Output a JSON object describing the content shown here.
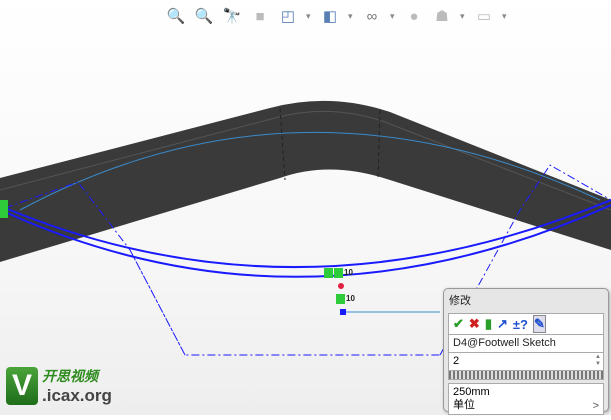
{
  "toolbar": {
    "icons": [
      "zoom-to-fit-icon",
      "zoom-area-icon",
      "previous-view-icon",
      "section-view-icon",
      "view-orientation-icon",
      "display-style-icon",
      "hide-show-icon",
      "edit-appearance-icon",
      "apply-scene-icon",
      "view-settings-icon"
    ]
  },
  "sketch": {
    "dim_label_1": "10",
    "dim_label_2": "10"
  },
  "modify_dialog": {
    "title": "修改",
    "dimension_name": "D4@Footwell Sketch",
    "value": "2",
    "current_value": "250mm",
    "units_label": "单位",
    "units_arrow": ">"
  },
  "watermark": {
    "cn": "开思视频",
    "en": ".icax.org",
    "letter": "V"
  },
  "colors": {
    "sketch": "#1a1aff",
    "bar": "#3a3a3a",
    "relation": "#2ecc3a"
  }
}
